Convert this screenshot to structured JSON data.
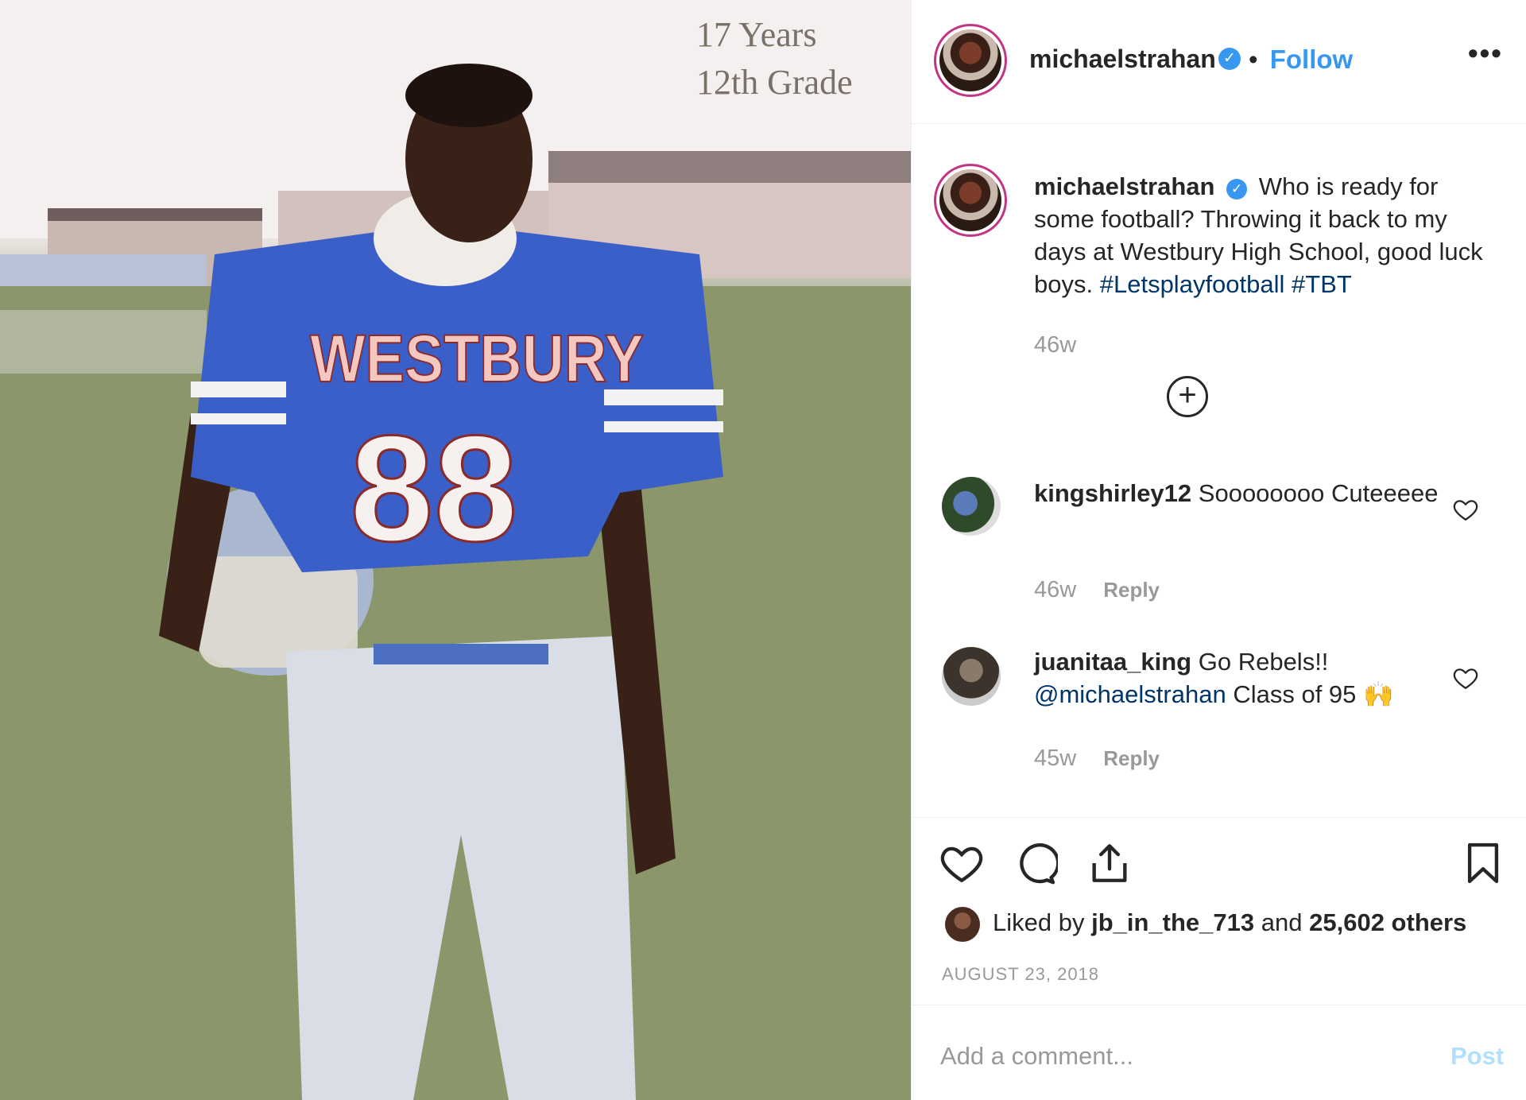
{
  "photo": {
    "caption_line1": "17 Years",
    "caption_line2": "12th Grade",
    "jersey_text": "WESTBURY",
    "jersey_number": "88"
  },
  "header": {
    "username": "michaelstrahan",
    "separator": "•",
    "follow_label": "Follow",
    "more_label": "•••"
  },
  "caption": {
    "username": "michaelstrahan",
    "text": "Who is ready for some football? Throwing it back to my days at Westbury High School, good luck boys.",
    "hashtag1": "#Letsplayfootball",
    "hashtag2": "#TBT",
    "age": "46w"
  },
  "load_more_label": "+",
  "comments": [
    {
      "username": "kingshirley12",
      "text": "Soooooooo Cuteeeee",
      "age": "46w",
      "reply_label": "Reply"
    },
    {
      "username": "juanitaa_king",
      "text_before": "Go Rebels!!",
      "mention": "@michaelstrahan",
      "text_after": "Class of 95 🙌",
      "age": "45w",
      "reply_label": "Reply"
    }
  ],
  "likes": {
    "prefix": "Liked by",
    "user": "jb_in_the_713",
    "joiner": "and",
    "others": "25,602 others"
  },
  "date": "AUGUST 23, 2018",
  "add_comment": {
    "placeholder": "Add a comment...",
    "post_label": "Post"
  },
  "colors": {
    "link_blue": "#3897f0",
    "hashtag_blue": "#003569",
    "muted": "#999999",
    "post_disabled": "#b2dffc"
  },
  "icons": [
    "heart-icon",
    "comment-icon",
    "share-icon",
    "bookmark-icon",
    "verified-badge-icon",
    "plus-circle-icon"
  ]
}
